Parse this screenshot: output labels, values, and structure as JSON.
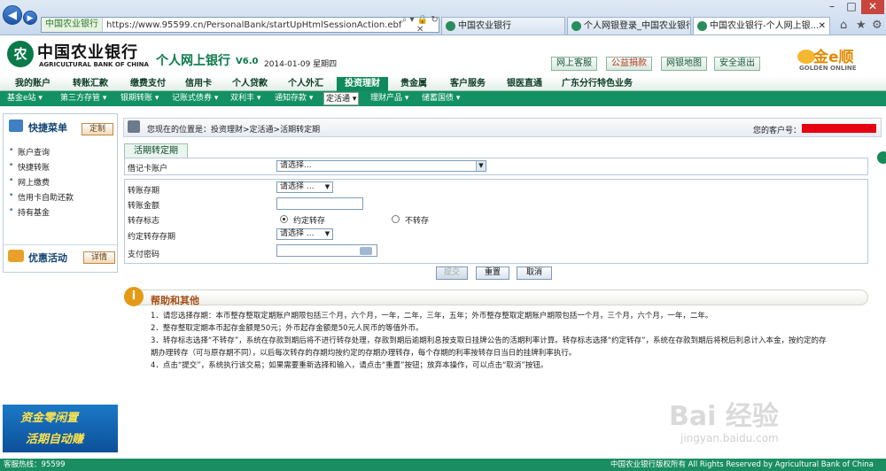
{
  "browser": {
    "site_label": "中国农业银行",
    "url": "https://www.95599.cn/PersonalBank/startUpHtmlSessionAction.ebf",
    "tabs": [
      {
        "label": "中国农业银行"
      },
      {
        "label": "个人网银登录_中国农业银行"
      },
      {
        "label": "中国农业银行-个人网上银..."
      }
    ],
    "window_controls": [
      "–",
      "□",
      "✕"
    ]
  },
  "header": {
    "bank_cn": "中国农业银行",
    "bank_en": "AGRICULTURAL BANK OF CHINA",
    "product": "个人网上银行",
    "version": "V6.0",
    "date": "2014-01-09 星期四",
    "buttons": [
      "网上客服",
      "公益捐款",
      "网银地图",
      "安全退出"
    ],
    "golden_cn": "金e顺",
    "golden_en": "GOLDEN ONLINE"
  },
  "main_nav": [
    "我的账户",
    "转账汇款",
    "缴费支付",
    "信用卡",
    "个人贷款",
    "个人外汇",
    "投资理财",
    "贵金属",
    "客户服务",
    "银医直通",
    "广东分行特色业务"
  ],
  "sub_nav": [
    "基金e站 ▾",
    "第三方存管 ▾",
    "银期转账 ▾",
    "记账式债券 ▾",
    "双利丰 ▾",
    "通知存款 ▾",
    "定活通 ▾",
    "理财产品 ▾",
    "储蓄国债 ▾"
  ],
  "sidebar": {
    "quick_title": "快捷菜单",
    "custom_btn": "定制",
    "items": [
      "账户查询",
      "快捷转账",
      "网上缴费",
      "信用卡自助还款",
      "持有基金"
    ],
    "promo_title": "优惠活动",
    "detail_btn": "详情",
    "ad_line1": "资金零闲置",
    "ad_line2": "活期自动赚"
  },
  "content": {
    "breadcrumb": "您现在的位置是：投资理财>定活通>活期转定期",
    "customer_label": "您的客户号：",
    "form_tab": "活期转定期",
    "fields": {
      "debit_label": "借记卡账户",
      "debit_value": "请选择...",
      "term_label": "转账存期",
      "term_value": "请选择 ...",
      "amount_label": "转账金额",
      "flag_label": "转存标志",
      "flag_opt1": "约定转存",
      "flag_opt2": "不转存",
      "agreed_term_label": "约定转存存期",
      "agreed_term_value": "请选择 ...",
      "password_label": "支付密码"
    },
    "buttons": {
      "submit": "提交",
      "reset": "重置",
      "cancel": "取消"
    }
  },
  "help": {
    "title": "帮助和其他",
    "lines": [
      "1．请您选择存期：本币整存整取定期账户期限包括三个月，六个月，一年，二年，三年，五年；外币整存整取定期账户期限包括一个月，三个月，六个月，一年，二年。",
      "2．整存整取定期本币起存金额是50元；外币起存金额是50元人民币的等值外币。",
      "3．转存标志选择“不转存”，系统在存款到期后将不进行转存处理，存款到期后逾期利息按支取日挂牌公告的活期利率计算。转存标志选择“约定转存”，系统在存款到期后将税后利息计入本金，按约定的存",
      "期办理转存（可与原存期不同），以后每次转存的存期均按约定的存期办理转存，每个存期的利率按转存日当日的挂牌利率执行。",
      "4．点击“提交”，系统执行该交易；如果需要重新选择和输入，请点击“重置”按钮；放弃本操作，可以点击“取消”按钮。"
    ]
  },
  "footer": {
    "hotline": "客服热线：95599",
    "copyright": "中国农业银行版权所有 All Rights Reserved by Agricultural Bank of China"
  },
  "watermark": {
    "line1": "Bai 经验",
    "line2": "jingyan.baidu.com"
  },
  "colors": {
    "brand_green": "#139164",
    "accent_orange": "#e59a17",
    "customer_mask": "#e50012"
  }
}
